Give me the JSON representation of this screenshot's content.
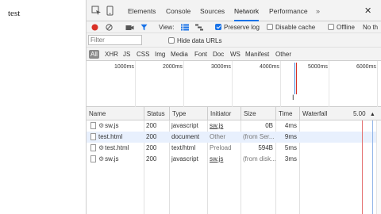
{
  "page": {
    "text": "test"
  },
  "tabs": {
    "items": [
      {
        "label": "Elements",
        "active": false
      },
      {
        "label": "Console",
        "active": false
      },
      {
        "label": "Sources",
        "active": false
      },
      {
        "label": "Network",
        "active": true
      },
      {
        "label": "Performance",
        "active": false
      }
    ],
    "more": "»"
  },
  "toolbar": {
    "view_label": "View:",
    "preserve_log": "Preserve log",
    "preserve_log_checked": true,
    "disable_cache": "Disable cache",
    "disable_cache_checked": false,
    "offline": "Offline",
    "throttling": "No th"
  },
  "filter": {
    "placeholder": "Filter",
    "hide_data_urls": "Hide data URLs"
  },
  "types": [
    "All",
    "XHR",
    "JS",
    "CSS",
    "Img",
    "Media",
    "Font",
    "Doc",
    "WS",
    "Manifest",
    "Other"
  ],
  "overview": {
    "ticks": [
      "1000ms",
      "2000ms",
      "3000ms",
      "4000ms",
      "5000ms",
      "6000ms"
    ]
  },
  "table": {
    "headers": [
      "Name",
      "Status",
      "Type",
      "Initiator",
      "Size",
      "Time",
      "Waterfall"
    ],
    "waterfall_scale": "5.00",
    "sort_icon": "▲",
    "rows": [
      {
        "name": "sw.js",
        "icon": "gear-icon",
        "status": "200",
        "type": "javascript",
        "initiator": "sw.js",
        "initiator_link": true,
        "size": "0B",
        "size_grey": false,
        "time": "4ms"
      },
      {
        "name": "test.html",
        "icon": "file-icon",
        "status": "200",
        "type": "document",
        "initiator": "Other",
        "initiator_link": false,
        "size": "(from Ser...",
        "size_grey": true,
        "time": "9ms"
      },
      {
        "name": "test.html",
        "icon": "gear-icon",
        "status": "200",
        "type": "text/html",
        "initiator": "Preload",
        "initiator_link": false,
        "size": "594B",
        "size_grey": false,
        "time": "5ms"
      },
      {
        "name": "sw.js",
        "icon": "gear-icon",
        "status": "200",
        "type": "javascript",
        "initiator": "sw.js",
        "initiator_link": true,
        "size": "(from disk...",
        "size_grey": true,
        "time": "3ms"
      }
    ]
  },
  "colors": {
    "accent": "#1a73e8",
    "record": "#d93025",
    "selected_row": "#e8f0fd"
  }
}
